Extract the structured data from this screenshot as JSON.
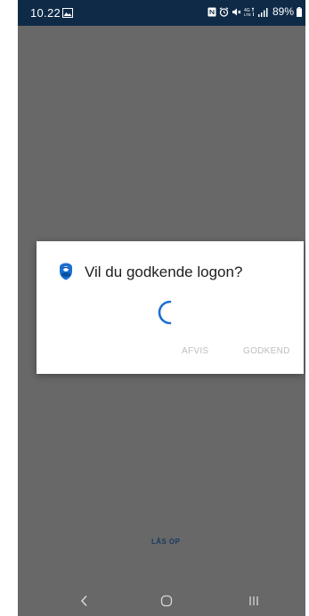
{
  "status_bar": {
    "time": "10.22",
    "battery": "89%"
  },
  "dialog": {
    "title": "Vil du godkende logon?",
    "reject_label": "AFVIS",
    "approve_label": "GODKEND"
  },
  "unlock_label": "LÅS OP",
  "icons": {
    "status": [
      "image-icon",
      "nfc-icon",
      "alarm-icon",
      "mute-icon",
      "lte-icon",
      "signal-icon",
      "battery-icon"
    ],
    "dialog": "authenticator-icon",
    "nav": [
      "back-icon",
      "home-icon",
      "recent-apps-icon"
    ]
  },
  "colors": {
    "status_bar": "#0e2a47",
    "background": "#686868",
    "accent": "#1a6fd1",
    "unlock": "#1b3a63"
  }
}
